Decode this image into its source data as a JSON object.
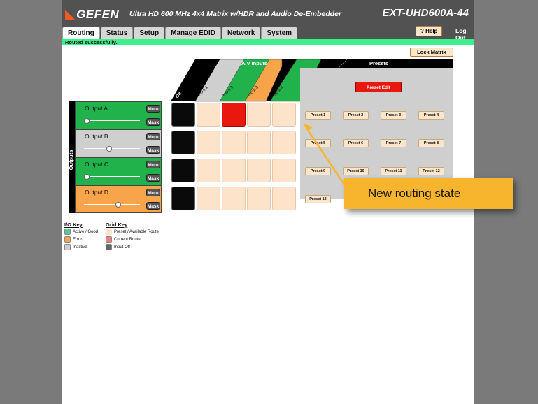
{
  "header": {
    "brand": "GEFEN",
    "product": "Ultra HD 600 MHz 4x4 Matrix w/HDR and Audio De-Embedder",
    "model": "EXT-UHD600A-44",
    "help_label": "? Help",
    "logout_label": "Log Out"
  },
  "tabs": [
    {
      "label": "Routing",
      "active": true
    },
    {
      "label": "Status",
      "active": false
    },
    {
      "label": "Setup",
      "active": false
    },
    {
      "label": "Manage EDID",
      "active": false
    },
    {
      "label": "Network",
      "active": false
    },
    {
      "label": "System",
      "active": false
    }
  ],
  "status_message": "Routed successfully.",
  "lock_matrix_label": "Lock Matrix",
  "matrix": {
    "inputs_header": "A/V Inputs",
    "presets_header": "Presets",
    "outputs_header": "A/V Outputs",
    "off_label": "Off",
    "inputs": [
      {
        "label": "Input 1",
        "color": "#cfcfcf"
      },
      {
        "label": "Input 2",
        "color": "#22b24c"
      },
      {
        "label": "Input 3",
        "color": "#f7a44a"
      },
      {
        "label": "Input 4",
        "color": "#22b24c"
      }
    ],
    "outputs": [
      {
        "name": "Output A",
        "color": "#22b24c",
        "mute": "Mute",
        "mask": "Mask",
        "volume": 0.0,
        "route": 2
      },
      {
        "name": "Output B",
        "color": "#cfcfcf",
        "mute": "Mute",
        "mask": "Mask",
        "volume": 0.45,
        "route": null
      },
      {
        "name": "Output C",
        "color": "#22b24c",
        "mute": "Mute",
        "mask": "Mask",
        "volume": 0.0,
        "route": null
      },
      {
        "name": "Output D",
        "color": "#f7a44a",
        "mute": "Mute",
        "mask": "Mask",
        "volume": 0.62,
        "route": null
      }
    ],
    "preset_edit_label": "Preset Edit",
    "presets": [
      "Preset 1",
      "Preset 2",
      "Preset 3",
      "Preset 4",
      "Preset 5",
      "Preset 6",
      "Preset 7",
      "Preset 8",
      "Preset 9",
      "Preset 10",
      "Preset 11",
      "Preset 12",
      "Preset 13"
    ]
  },
  "io_key": {
    "title": "I/O Key",
    "items": [
      {
        "label": "Active / Good",
        "color": "#5cc79a"
      },
      {
        "label": "Error",
        "color": "#f7a44a"
      },
      {
        "label": "Inactive",
        "color": "#cfcfcf"
      }
    ]
  },
  "grid_key": {
    "title": "Grid Key",
    "items": [
      {
        "label": "Preset / Available Route",
        "color": "#fde3c9"
      },
      {
        "label": "Current Route",
        "color": "#f08080"
      },
      {
        "label": "Input Off",
        "color": "#666666"
      }
    ]
  },
  "callout": {
    "text": "New routing state"
  }
}
